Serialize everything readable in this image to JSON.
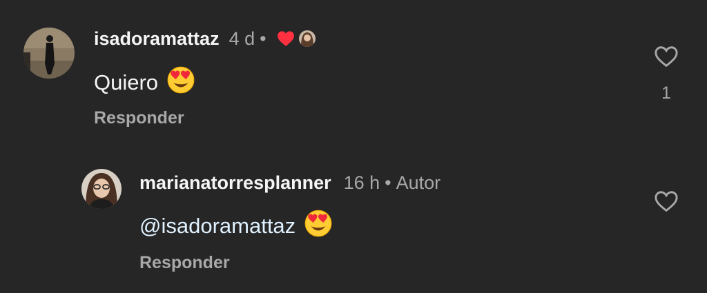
{
  "comments": [
    {
      "username": "isadoramattaz",
      "time": "4 d",
      "text": "Quiero",
      "reply_label": "Responder",
      "like_count": "1",
      "liked_by_author": true
    }
  ],
  "replies": [
    {
      "username": "marianatorresplanner",
      "time": "16 h",
      "author_badge": "Autor",
      "mention": "@isadoramattaz",
      "reply_label": "Responder"
    }
  ],
  "separator": "•",
  "icons": {
    "like": "heart-outline-icon",
    "liked": "heart-filled-icon",
    "emoji": "heart-eyes-emoji"
  },
  "colors": {
    "background": "#262626",
    "text_primary": "#f5f5f5",
    "text_secondary": "#a8a8a8",
    "heart_red": "#ff3040",
    "mention": "#e0f1ff"
  }
}
